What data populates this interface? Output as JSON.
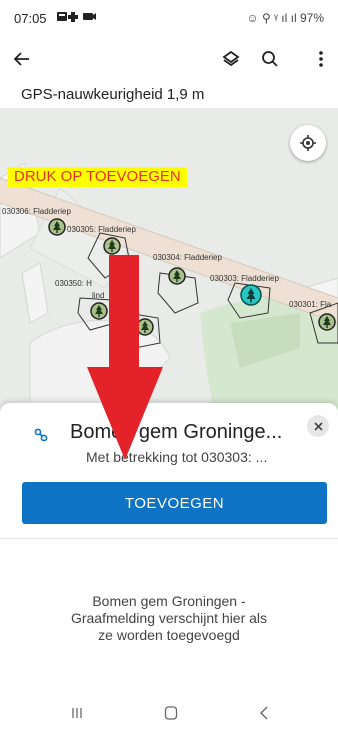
{
  "status_bar": {
    "time": "07:05",
    "right": "☺ ⚲ ᵞ ıl ıl 97%"
  },
  "app_bar": {
    "back_icon": "arrow-left-icon",
    "layers_icon": "layers-icon",
    "search_icon": "search-icon",
    "menu_icon": "more-vert-icon"
  },
  "gps": {
    "text": "GPS-nauwkeurigheid 1,9 m"
  },
  "map": {
    "instruction": "DRUK OP TOEVOEGEN",
    "labels": [
      "030306: Fladderiep",
      "030305: Fladderiep",
      "030304: Fladderiep",
      "030303: Fladderiep",
      "030350: H",
      "lind",
      "030301: Fla"
    ],
    "colors": {
      "road": "#eee0d4",
      "tree_fill": "#a8c18a",
      "tree_selected": "#25c7c3",
      "arrow": "#e3222a",
      "highlight": "#ffff00"
    }
  },
  "panel": {
    "title": "Bomen gem Groninge...",
    "subtitle": "Met betrekking tot 030303: ...",
    "add_label": "TOEVOEGEN",
    "empty_text": "Bomen gem Groningen - Graafmelding verschijnt hier als ze worden toegevoegd",
    "accent": "#0e73c4"
  }
}
